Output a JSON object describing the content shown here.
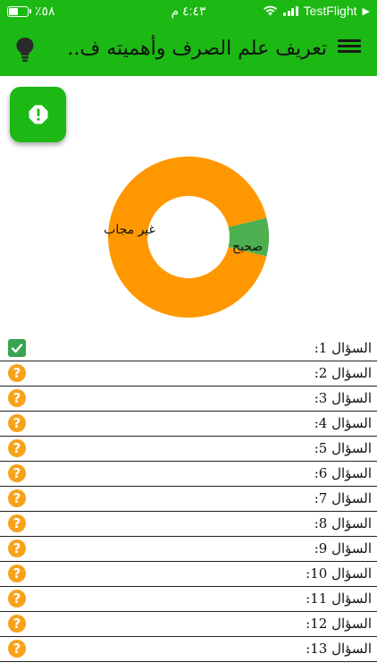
{
  "status_bar": {
    "battery": "٪٥٨",
    "battery_level": 0.58,
    "time": "٤:٤٣ م",
    "carrier": "TestFlight"
  },
  "header": {
    "title": "تعريف علم الصرف وأهميته ف...",
    "menu_icon": "hamburger-menu-icon",
    "hint_icon": "lightbulb-icon",
    "background": "#1cb814"
  },
  "fab": {
    "icon": "alert-icon"
  },
  "chart_data": {
    "type": "pie",
    "labels": [
      "غير مجاب",
      "صحيح"
    ],
    "values": [
      12,
      1
    ],
    "colors": [
      "#ff9800",
      "#4caf50"
    ]
  },
  "questions": [
    {
      "label": "السؤال 1:",
      "status": "correct"
    },
    {
      "label": "السؤال 2:",
      "status": "unanswered"
    },
    {
      "label": "السؤال 3:",
      "status": "unanswered"
    },
    {
      "label": "السؤال 4:",
      "status": "unanswered"
    },
    {
      "label": "السؤال 5:",
      "status": "unanswered"
    },
    {
      "label": "السؤال 6:",
      "status": "unanswered"
    },
    {
      "label": "السؤال 7:",
      "status": "unanswered"
    },
    {
      "label": "السؤال 8:",
      "status": "unanswered"
    },
    {
      "label": "السؤال 9:",
      "status": "unanswered"
    },
    {
      "label": "السؤال 10:",
      "status": "unanswered"
    },
    {
      "label": "السؤال 11:",
      "status": "unanswered"
    },
    {
      "label": "السؤال 12:",
      "status": "unanswered"
    },
    {
      "label": "السؤال 13:",
      "status": "unanswered"
    }
  ]
}
